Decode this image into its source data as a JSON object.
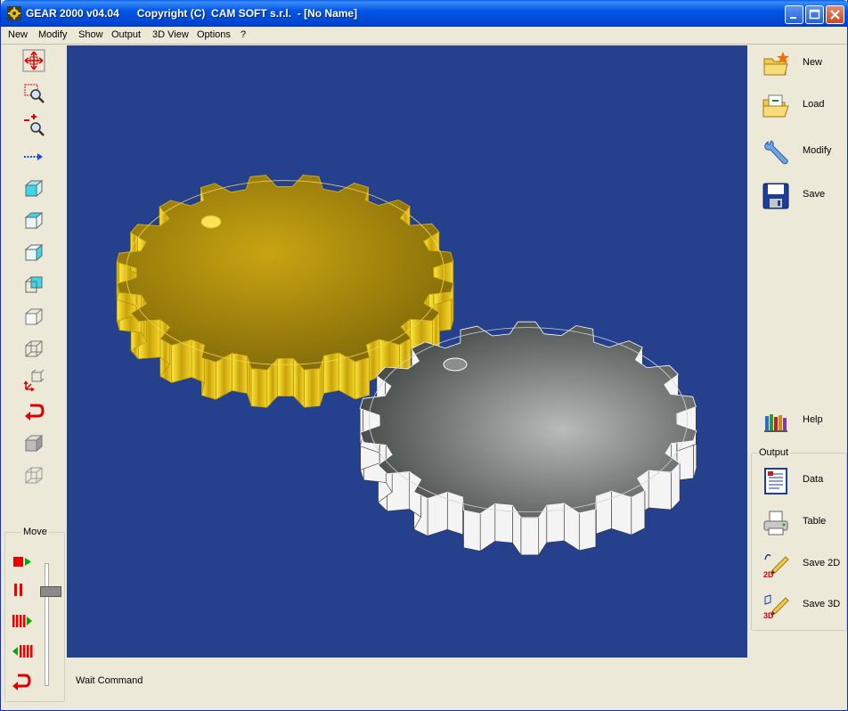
{
  "window": {
    "title": "GEAR 2000 v04.04      Copyright (C)  CAM SOFT s.r.l.  - [No Name]"
  },
  "menu": [
    "New",
    "Modify",
    "Show",
    "Output",
    "3D View",
    "Options",
    "?"
  ],
  "left_toolbar": {
    "icons": [
      "pan-icon",
      "zoom-window-icon",
      "zoom-in-out-icon",
      "redraw-arrow-icon",
      "view-front-icon",
      "view-top-icon",
      "view-side-icon",
      "view-back-icon",
      "view-bottom-icon",
      "view-iso-icon",
      "axes-view-icon",
      "undo-view-icon",
      "solid-render-icon",
      "wireframe-icon"
    ]
  },
  "move_panel": {
    "label": "Move",
    "buttons": [
      "stop-play-icon",
      "pause-icon",
      "step-forward-icon",
      "step-back-icon",
      "reset-icon"
    ]
  },
  "status": "Wait Command",
  "right_toolbar": {
    "items": [
      {
        "label": "New",
        "icon": "new-file-icon"
      },
      {
        "label": "Load",
        "icon": "open-folder-icon"
      },
      {
        "label": "Modify",
        "icon": "wrench-icon"
      },
      {
        "label": "Save",
        "icon": "floppy-disk-icon"
      },
      {
        "label": "Help",
        "icon": "books-icon"
      }
    ]
  },
  "output_panel": {
    "label": "Output",
    "items": [
      {
        "label": "Data",
        "icon": "document-data-icon"
      },
      {
        "label": "Table",
        "icon": "printer-icon"
      },
      {
        "label": "Save 2D",
        "icon": "pencil-2d-icon"
      },
      {
        "label": "Save 3D",
        "icon": "pencil-3d-icon"
      }
    ]
  },
  "colors": {
    "viewport_bg": "#25408c",
    "gold_gear": "#e8c40a",
    "gray_gear": "#8e9392"
  },
  "gears": [
    {
      "name": "gold-gear",
      "teeth": 20
    },
    {
      "name": "gray-gear",
      "teeth": 18
    }
  ]
}
